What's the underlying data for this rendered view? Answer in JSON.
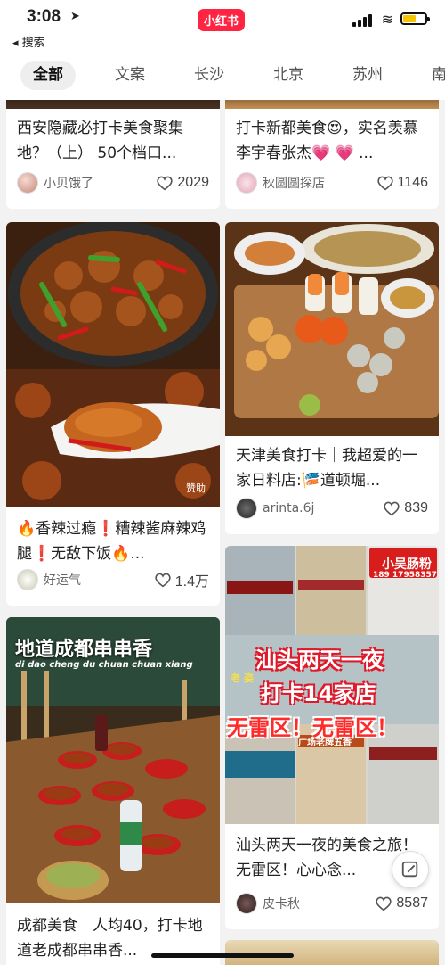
{
  "status_bar": {
    "time": "3:08",
    "location_glyph": "➤",
    "back_label": "◂ 搜索",
    "brand": "小红书",
    "wifi_glyph": "≋"
  },
  "tabs": [
    "全部",
    "文案",
    "长沙",
    "北京",
    "苏州",
    "南"
  ],
  "cards": [
    {
      "title": "西安隐藏必打卡美食聚集地？（上） 50个档口...",
      "author": "小贝饿了",
      "likes": "2029"
    },
    {
      "title": "打卡新都美食😍，实名羡慕李宇春张杰💗 💗 ...",
      "author": "秋圆圆探店",
      "likes": "1146"
    },
    {
      "title": "🔥香辣过瘾❗糟辣酱麻辣鸡腿❗无敌下饭🔥...",
      "author": "好运气",
      "likes": "1.4万",
      "sponsor_label": "赞助"
    },
    {
      "title": "天津美食打卡｜我超爱的一家日料店:🎏道顿堀...",
      "author": "arinta.6j",
      "likes": "839"
    },
    {
      "title": "成都美食｜人均40，打卡地道老成都串串香...",
      "author": "",
      "likes": "",
      "overlay_title": "地道成都串串香",
      "overlay_pinyin": "di dao cheng du chuan chuan xiang"
    },
    {
      "title": "汕头两天一夜的美食之旅！无雷区！心心念...",
      "author": "皮卡秋",
      "likes": "8587",
      "overlay_line1": "汕头两天一夜",
      "overlay_line2": "打卡14家店",
      "overlay_line3": "无雷区！无雷区！",
      "shop_sign": "小吴肠粉",
      "shop_phone": "189 17958357",
      "shop_sign2": "广场老牌五香",
      "shop_sign3": "老 姿"
    }
  ]
}
